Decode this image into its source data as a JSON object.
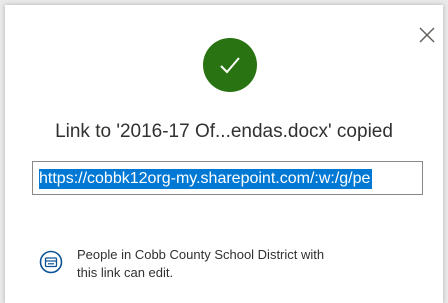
{
  "dialog": {
    "close_icon": "close-icon",
    "status_icon": "checkmark-icon",
    "colors": {
      "success": "#2a7312",
      "selection": "#0078d4",
      "text": "#323130"
    },
    "title": "Link to '2016-17 Of...endas.docx' copied",
    "link_value": "https://cobbk12org-my.sharepoint.com/:w:/g/pe",
    "permission_icon": "people-link-icon",
    "permission_text_line1": "People in Cobb County School District with",
    "permission_text_line2": "this link can edit."
  }
}
